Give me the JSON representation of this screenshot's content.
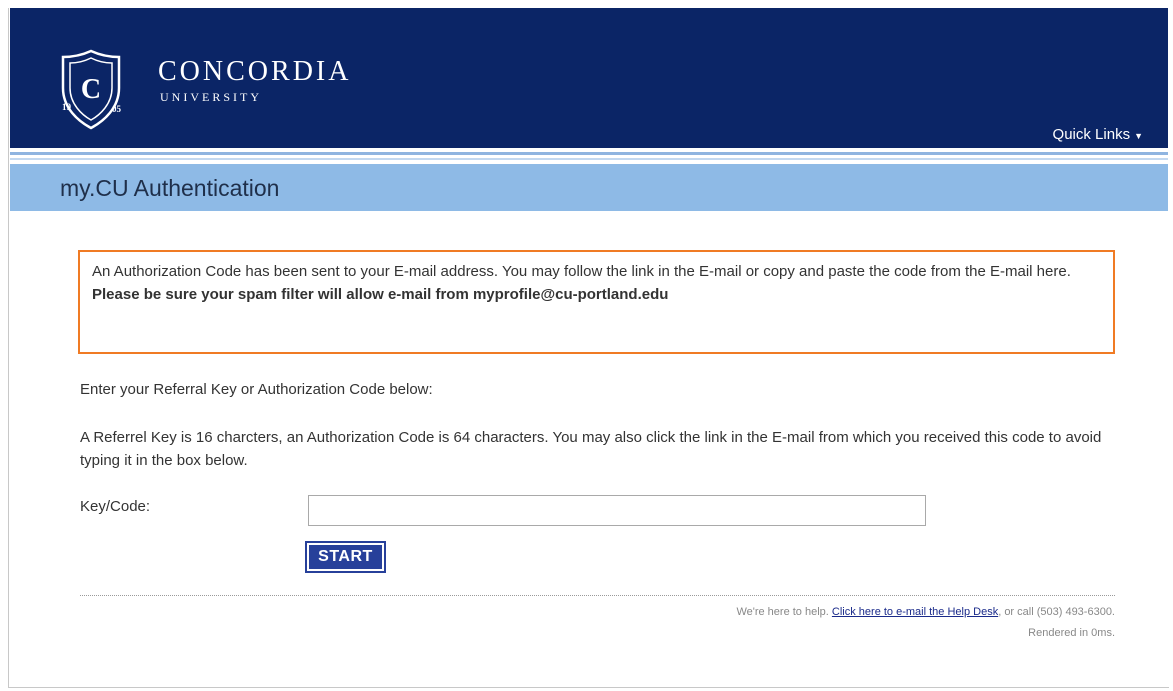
{
  "header": {
    "logo": {
      "name": "CONCORDIA",
      "sub": "UNIVERSITY",
      "shield_letter": "C",
      "year_left": "19",
      "year_right": "05"
    },
    "quick_links_label": "Quick Links",
    "quick_links_icon": "caret-down-icon"
  },
  "page": {
    "title": "my.CU Authentication"
  },
  "notice": {
    "message": "An Authorization Code has been sent to your E-mail address. You may follow the link in the E-mail or copy and paste the code from the E-mail here.",
    "warning": "Please be sure your spam filter will allow e-mail from myprofile@cu-portland.edu"
  },
  "instructions": {
    "prompt": "Enter your Referral Key or Authorization Code below:",
    "detail": "A Referrel Key is 16 charcters, an Authorization Code is 64 characters. You may also click the link in the E-mail from which you received this code to avoid typing it in the box below."
  },
  "form": {
    "key_label": "Key/Code:",
    "key_value": "",
    "start_label": "START"
  },
  "footer": {
    "help_prefix": "We're here to help.",
    "help_link": "Click here to e-mail the Help Desk",
    "help_suffix": ", or call (503) 493-6300.",
    "rendered": "Rendered in 0ms."
  },
  "colors": {
    "header_bg": "#0b2566",
    "title_bar_bg": "#8ebae6",
    "notice_border": "#f07b24",
    "button_bg": "#27409a"
  }
}
